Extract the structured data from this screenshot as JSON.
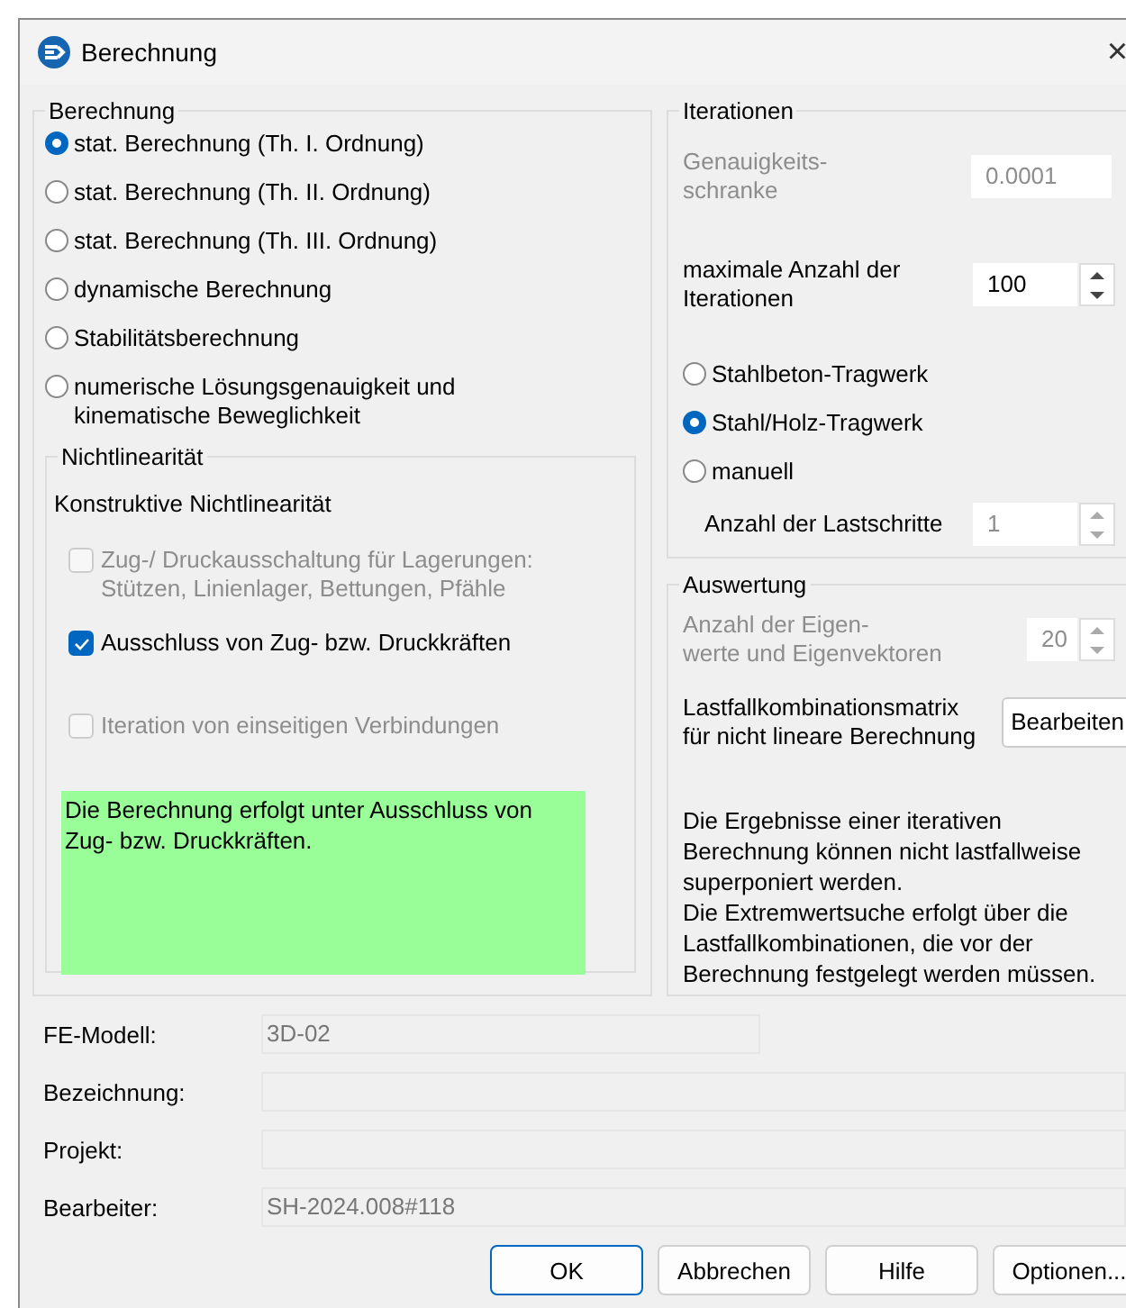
{
  "window": {
    "title": "Berechnung",
    "close": "×"
  },
  "calculation": {
    "title": "Berechnung",
    "options": [
      {
        "label": "stat. Berechnung (Th. I. Ordnung)",
        "selected": true
      },
      {
        "label": "stat. Berechnung (Th. II. Ordnung)",
        "selected": false
      },
      {
        "label": "stat. Berechnung (Th. III. Ordnung)",
        "selected": false
      },
      {
        "label": "dynamische Berechnung",
        "selected": false
      },
      {
        "label": "Stabilitätsberechnung",
        "selected": false
      },
      {
        "label": "numerische Lösungsgenauigkeit und kinematische Beweglichkeit",
        "selected": false
      }
    ]
  },
  "nonlinearity": {
    "title": "Nichtlinearität",
    "subtitle": "Konstruktive Nichtlinearität",
    "checks": [
      {
        "label": "Zug-/ Druckausschaltung für Lagerungen: Stützen, Linienlager, Bettungen, Pfähle",
        "checked": false,
        "disabled": true
      },
      {
        "label": "Ausschluss von Zug- bzw. Druckkräften",
        "checked": true,
        "disabled": false
      },
      {
        "label": "Iteration von einseitigen Verbindungen",
        "checked": false,
        "disabled": true
      }
    ],
    "note": "Die Berechnung erfolgt unter Ausschluss von Zug- bzw. Druckkräften."
  },
  "iterations": {
    "title": "Iterationen",
    "tolerance": {
      "label": "Genauigkeits-\nschranke",
      "value": "0.0001",
      "disabled": true
    },
    "max_iterations": {
      "label": "maximale Anzahl der Iterationen",
      "value": "100",
      "disabled": false
    },
    "structure": [
      {
        "label": "Stahlbeton-Tragwerk",
        "selected": false
      },
      {
        "label": "Stahl/Holz-Tragwerk",
        "selected": true
      },
      {
        "label": "manuell",
        "selected": false
      }
    ],
    "load_steps": {
      "label": "Anzahl der Lastschritte",
      "value": "1",
      "disabled": true
    }
  },
  "evaluation": {
    "title": "Auswertung",
    "eigen": {
      "label": "Anzahl der Eigen-\nwerte und Eigenvektoren",
      "value": "20",
      "disabled": true
    },
    "matrix": {
      "label": "Lastfallkombinationsmatrix\nfür nicht lineare Berechnung",
      "button": "Bearbeiten"
    },
    "info": "Die Ergebnisse einer iterativen Berechnung können nicht lastfallweise superponiert werden.\nDie Extremwertsuche erfolgt über die Lastfallkombinationen, die vor der Berechnung festgelegt werden müssen."
  },
  "fields": [
    {
      "label": "FE-Modell:",
      "value": "3D-02",
      "short": true
    },
    {
      "label": "Bezeichnung:",
      "short": false
    },
    {
      "label": "Projekt:",
      "short": false
    },
    {
      "label": "Bearbeiter:",
      "value": "SH-2024.008#118",
      "short": false
    }
  ],
  "buttons": [
    {
      "label": "OK",
      "default": true
    },
    {
      "label": "Abbrechen",
      "default": false
    },
    {
      "label": "Hilfe",
      "default": false
    },
    {
      "label": "Optionen...",
      "default": false
    }
  ]
}
